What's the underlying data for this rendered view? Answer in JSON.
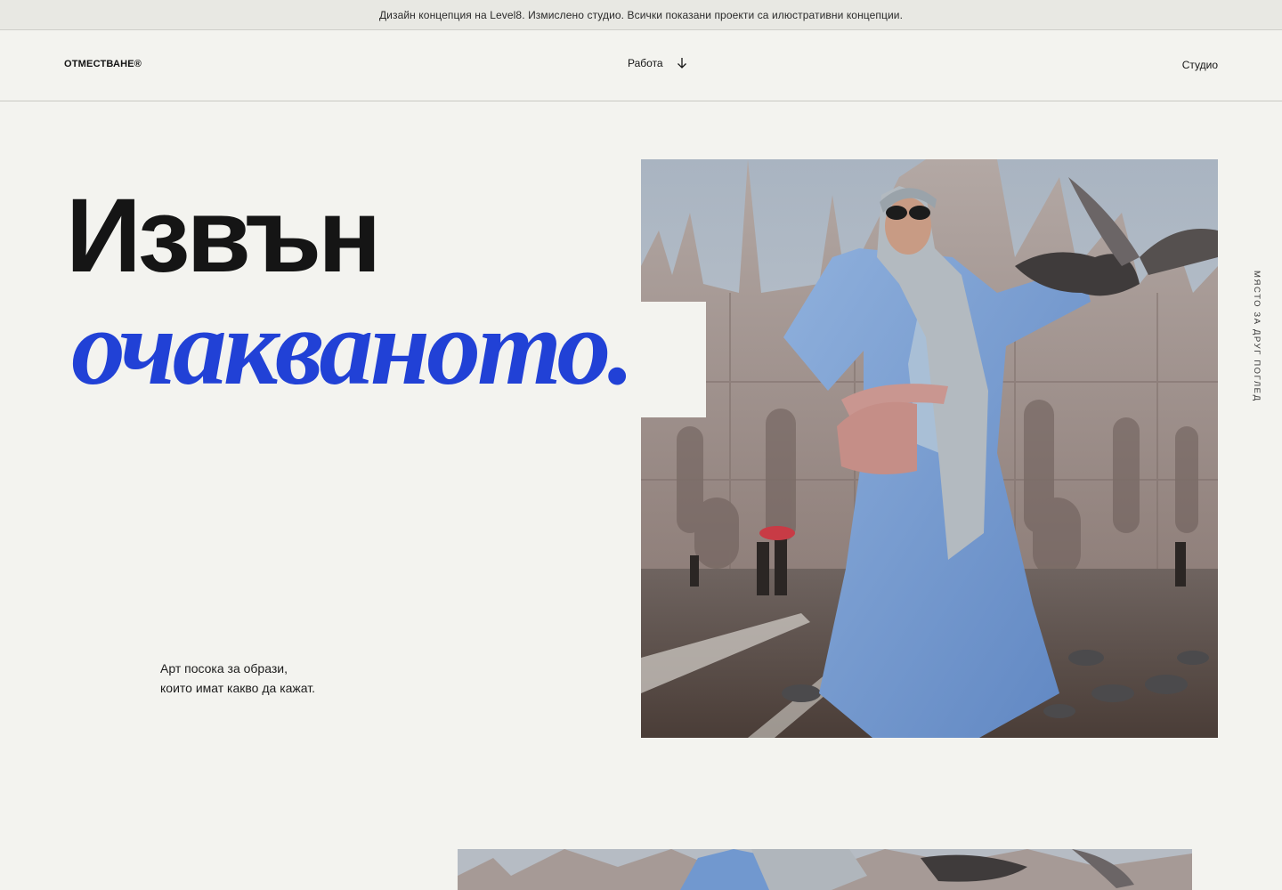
{
  "banner": {
    "text": "Дизайн концепция на Level8. Измислено студио. Всички показани проекти са илюстративни концепции."
  },
  "nav": {
    "logo": "ОТМЕСТВАНЕ®",
    "work_label": "Работа",
    "work_icon": "arrow-down-icon",
    "studio_label": "Студио"
  },
  "hero": {
    "line1": "Извън",
    "line2": "очакваното.",
    "tagline_line1": "Арт посока за образи,",
    "tagline_line2": "които имат какво да кажат.",
    "vertical_text": "МЯСТО ЗА ДРУГ ПОГЛЕД"
  },
  "colors": {
    "background": "#f3f3ef",
    "accent": "#2141d6",
    "text": "#141414"
  }
}
